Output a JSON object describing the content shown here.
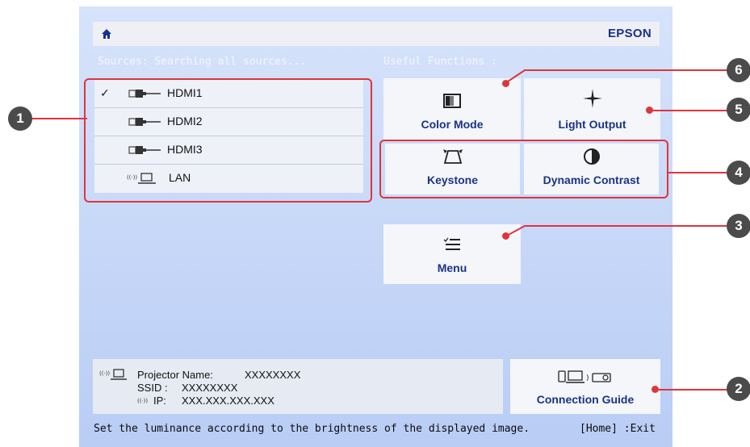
{
  "header": {
    "brand": "EPSON"
  },
  "sources": {
    "label": "Sources: Searching all sources...",
    "items": [
      {
        "label": "HDMI1",
        "selected": true,
        "icon": "hdmi-plug-icon"
      },
      {
        "label": "HDMI2",
        "selected": false,
        "icon": "hdmi-plug-icon"
      },
      {
        "label": "HDMI3",
        "selected": false,
        "icon": "hdmi-plug-icon"
      },
      {
        "label": "LAN",
        "selected": false,
        "icon": "network-computer-icon"
      }
    ],
    "check_glyph": "✓"
  },
  "useful_functions": {
    "label": "Useful Functions :",
    "color_mode": "Color Mode",
    "light_output": "Light Output",
    "keystone": "Keystone",
    "dynamic_contrast": "Dynamic Contrast",
    "menu": "Menu"
  },
  "info": {
    "projector_name_label": "Projector Name:",
    "projector_name_value": "XXXXXXXX",
    "ssid_label": "SSID :",
    "ssid_value": "XXXXXXXX",
    "ip_label": "IP:",
    "ip_value": "XXX.XXX.XXX.XXX"
  },
  "connection_guide": "Connection Guide",
  "status_bar": {
    "message": "Set the luminance according to the brightness of the displayed image.",
    "exit_hint": "[Home] :Exit"
  },
  "callouts": [
    "1",
    "2",
    "3",
    "4",
    "5",
    "6"
  ],
  "colors": {
    "accent_red": "#e0343c",
    "brand_blue": "#1a2f8f",
    "screen_bg": "#c4d5f7"
  }
}
